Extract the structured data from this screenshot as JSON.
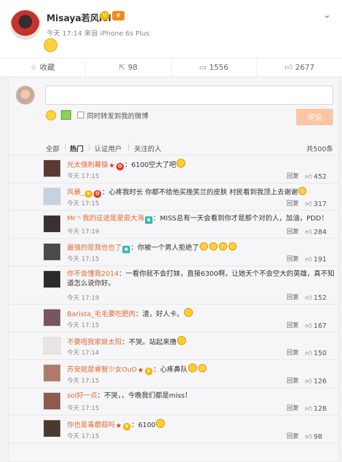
{
  "post": {
    "username": "Misaya若风lol",
    "meta": "今天 17:14 来自 iPhone 6s Plus"
  },
  "actions": {
    "favorite": "收藏",
    "repost": "98",
    "comment": "1556",
    "like": "2677"
  },
  "composer": {
    "placeholder": "",
    "repost_option": "同时转发到我的微博",
    "submit": "评论"
  },
  "tabs": {
    "all": "全部",
    "hot": "热门",
    "verified": "认证用户",
    "following": "关注的人",
    "count": "共500条"
  },
  "comments": [
    {
      "user": "光太强刺幕猫",
      "text": "：6100空大了吧",
      "time": "今天 17:15",
      "reply": "回复",
      "likes": "452"
    },
    {
      "user": "风暴_",
      "text": "：心疼我时长 你都不给他买挽笑兰的皮肤 村民看到我顶上去谢谢",
      "time": "今天 17:15",
      "reply": "回复",
      "likes": "317"
    },
    {
      "user": "Mr丶我的征途是星辰大海",
      "text": "：MISS总有一天会看到你才是那个对的人，加油，PDD！",
      "time": "今天 17:19",
      "reply": "回复",
      "likes": "284"
    },
    {
      "user": "最强的是我也也了",
      "text": "：你被一个男人拒绝了",
      "time": "今天 17:15",
      "reply": "回复",
      "likes": "191"
    },
    {
      "user": "你不会懂我2014",
      "text": "：一看你就不会打妹，直接6300啊，让她天个不会空大的英雄，真不知道怎么说你好。",
      "time": "今天 17:19",
      "reply": "回复",
      "likes": "152"
    },
    {
      "user": "Barista_毛毛要吃肥肉",
      "text": "：渣，好人卡。",
      "time": "今天 17:15",
      "reply": "回复",
      "likes": "167"
    },
    {
      "user": "不要唔我家姬太阳",
      "text": "：不哭。站起来撸",
      "time": "今天 17:14",
      "reply": "回复",
      "likes": "150"
    },
    {
      "user": "苏安妮是睿智少女OuO",
      "text": "：心疼鼻队",
      "time": "今天 17:15",
      "reply": "回复",
      "likes": "126"
    },
    {
      "user": "sol好一点",
      "text": "：不哭，，今晚我们都是miss！",
      "time": "今天 17:15",
      "reply": "回复",
      "likes": "128"
    },
    {
      "user": "你也是毒蘑菇吗",
      "text": "：6100",
      "time": "今天 17:15",
      "reply": "回复",
      "likes": "98"
    }
  ]
}
